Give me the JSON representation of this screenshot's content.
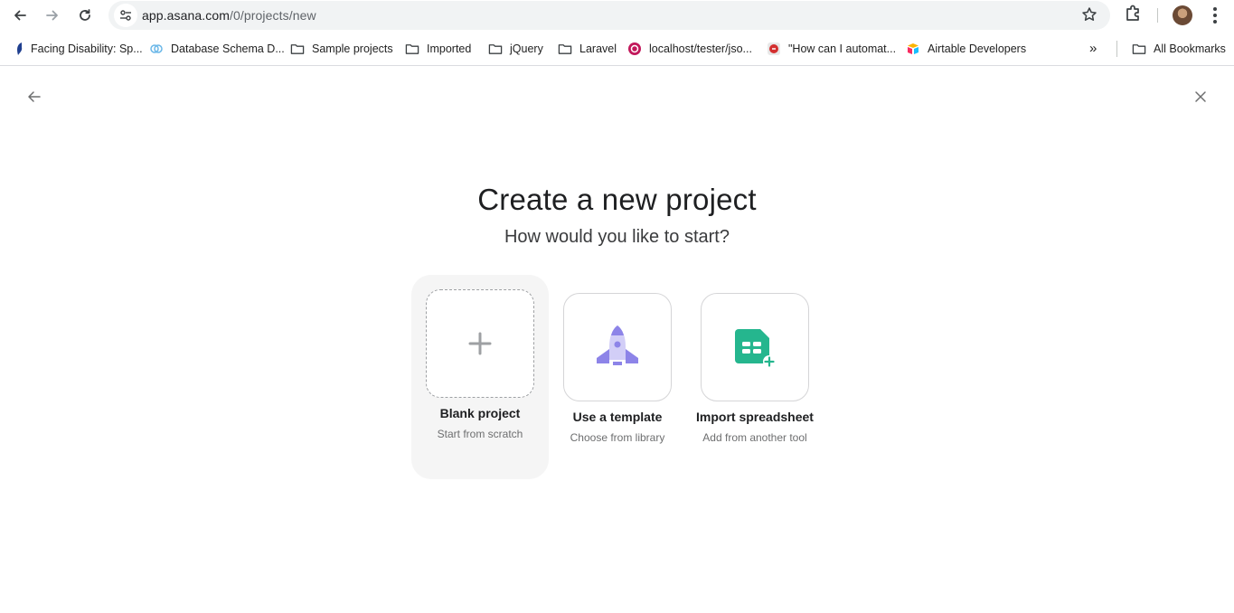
{
  "browser": {
    "url_host": "app.asana.com",
    "url_path": "/0/projects/new",
    "bookmarks": [
      {
        "label": "Facing Disability: Sp...",
        "icon": "facing-disability-favicon"
      },
      {
        "label": "Database Schema D...",
        "icon": "database-schema-favicon"
      },
      {
        "label": "Sample projects",
        "icon": "folder-icon"
      },
      {
        "label": "Imported",
        "icon": "folder-icon"
      },
      {
        "label": "jQuery",
        "icon": "folder-icon"
      },
      {
        "label": "Laravel",
        "icon": "folder-icon"
      },
      {
        "label": "localhost/tester/jso...",
        "icon": "localhost-favicon"
      },
      {
        "label": "\"How can I automat...",
        "icon": "stackexchange-favicon"
      },
      {
        "label": "Airtable Developers",
        "icon": "airtable-favicon"
      }
    ],
    "overflow_label": "»",
    "all_bookmarks_label": "All Bookmarks"
  },
  "page": {
    "title": "Create a new project",
    "subtitle": "How would you like to start?",
    "options": [
      {
        "label": "Blank project",
        "description": "Start from scratch",
        "icon": "plus-icon",
        "selected": true
      },
      {
        "label": "Use a template",
        "description": "Choose from library",
        "icon": "rocket-icon",
        "selected": false
      },
      {
        "label": "Import spreadsheet",
        "description": "Add from another tool",
        "icon": "spreadsheet-icon",
        "selected": false
      }
    ]
  },
  "colors": {
    "accent_purple": "#8d84e8",
    "accent_green": "#25b68e",
    "selected_background": "#f5f5f5"
  }
}
